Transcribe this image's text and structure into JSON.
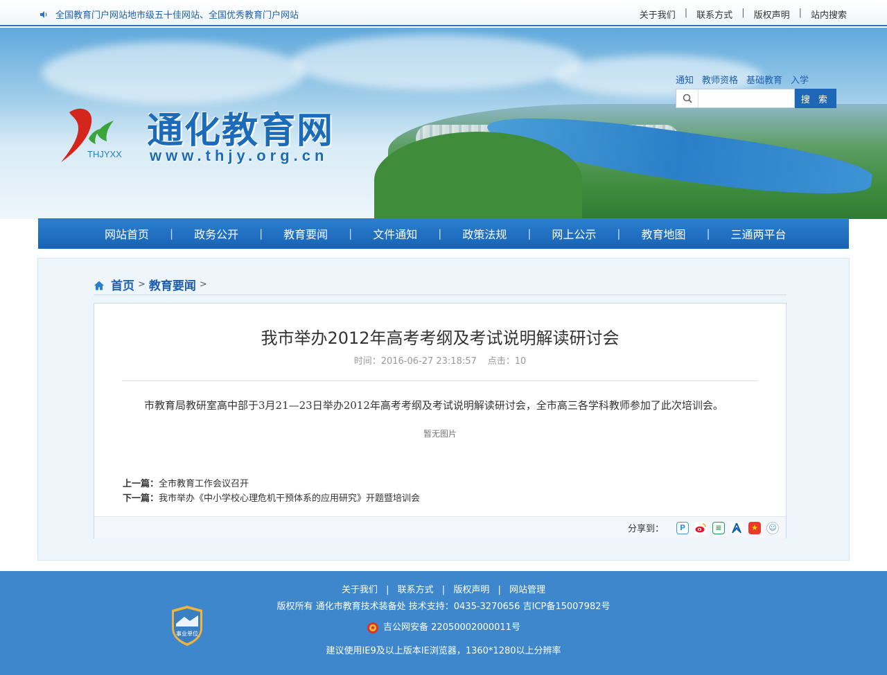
{
  "topbar": {
    "notice": "全国教育门户网站地市级五十佳网站、全国优秀教育门户网站",
    "links": [
      "关于我们",
      "联系方式",
      "版权声明",
      "站内搜索"
    ]
  },
  "header": {
    "logo_sub": "THJYXX",
    "site_title": "通化教育网",
    "site_url": "www.thjy.org.cn",
    "quick_links": [
      "通知",
      "教师资格",
      "基础教育",
      "入学"
    ],
    "search_button": "搜 索",
    "search_placeholder": ""
  },
  "nav": {
    "items": [
      "网站首页",
      "政务公开",
      "教育要闻",
      "文件通知",
      "政策法规",
      "网上公示",
      "教育地图",
      "三通两平台"
    ]
  },
  "breadcrumb": {
    "home": "首页",
    "current": "教育要闻",
    "sep": ">"
  },
  "article": {
    "title": "我市举办2012年高考考纲及考试说明解读研讨会",
    "time_label": "时间：2016-06-27 23:18:57",
    "hits_label": "点击：10",
    "body": "市教育局教研室高中部于3月21—23日举办2012年高考考纲及考试说明解读研讨会，全市高三各学科教师参加了此次培训会。",
    "no_image": "暂无图片",
    "prev_label": "上一篇：",
    "prev_title": "全市教育工作会议召开",
    "next_label": "下一篇：",
    "next_title": "我市举办《中小学校心理危机干预体系的应用研究》开题暨培训会",
    "share_label": "分享到："
  },
  "footer": {
    "links": [
      "关于我们",
      "联系方式",
      "版权声明",
      "网站管理"
    ],
    "copyright": "版权所有  通化市教育技术装备处  技术支持：0435-3270656  吉ICP备15007982号",
    "police": "吉公网安备 22050002000011号",
    "browser_tip": "建议使用IE9及以上版本IE浏览器，1360*1280以上分辨率",
    "badge_text": "事业单位"
  },
  "colors": {
    "brand_blue": "#1d66b8",
    "footer_blue": "#3f87cc",
    "panel_bg": "#eef5fb"
  }
}
